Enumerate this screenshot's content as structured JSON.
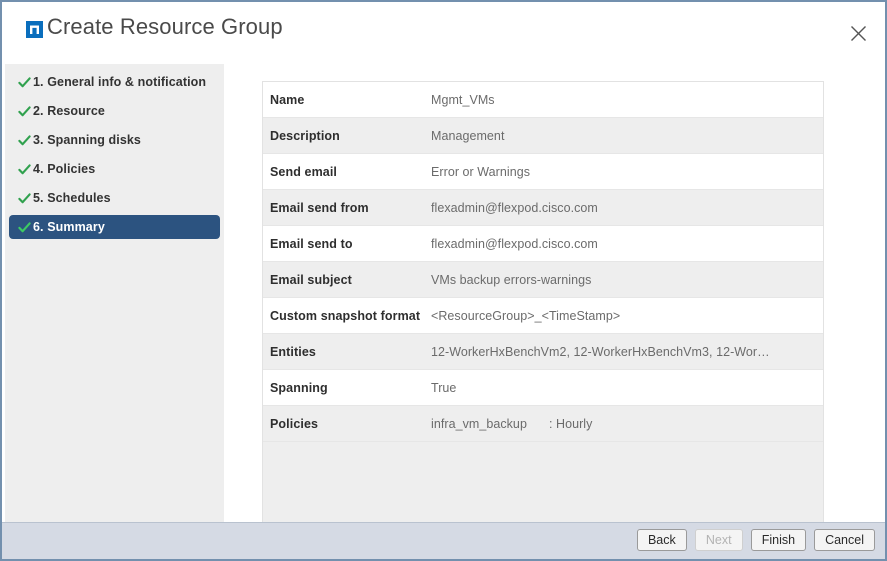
{
  "header": {
    "title": "Create Resource Group",
    "logo_icon": "netapp-logo-icon",
    "close_icon": "close-icon"
  },
  "sidebar": {
    "steps": [
      {
        "label": "1. General info & notification",
        "state": "complete",
        "icon": "check-icon"
      },
      {
        "label": "2. Resource",
        "state": "complete",
        "icon": "check-icon"
      },
      {
        "label": "3. Spanning disks",
        "state": "complete",
        "icon": "check-icon"
      },
      {
        "label": "4. Policies",
        "state": "complete",
        "icon": "check-icon"
      },
      {
        "label": "5. Schedules",
        "state": "complete",
        "icon": "check-icon"
      },
      {
        "label": "6. Summary",
        "state": "active",
        "icon": "check-icon"
      }
    ]
  },
  "summary": {
    "rows": [
      {
        "label": "Name",
        "value": "Mgmt_VMs"
      },
      {
        "label": "Description",
        "value": "Management"
      },
      {
        "label": "Send email",
        "value": "Error or Warnings"
      },
      {
        "label": "Email send from",
        "value": "flexadmin@flexpod.cisco.com"
      },
      {
        "label": "Email send to",
        "value": "flexadmin@flexpod.cisco.com"
      },
      {
        "label": "Email subject",
        "value": "VMs backup errors-warnings"
      },
      {
        "label": "Custom snapshot format",
        "value": "<ResourceGroup>_<TimeStamp>"
      },
      {
        "label": "Entities",
        "value": "12-WorkerHxBenchVm2, 12-WorkerHxBenchVm3, 12-Wor…"
      },
      {
        "label": "Spanning",
        "value": "True"
      },
      {
        "label": "Policies",
        "value": "infra_vm_backup",
        "value_suffix": ": Hourly"
      }
    ]
  },
  "footer": {
    "buttons": [
      {
        "label": "Back",
        "enabled": true
      },
      {
        "label": "Next",
        "enabled": false
      },
      {
        "label": "Finish",
        "enabled": true
      },
      {
        "label": "Cancel",
        "enabled": true
      }
    ]
  },
  "colors": {
    "accent_blue": "#0a6ebd",
    "active_step_bg": "#2c5380",
    "check_green": "#30a14e",
    "sidebar_bg": "#eeeeee",
    "footer_bg": "#d5dae4",
    "page_border": "#7390ae",
    "label_text": "#2e2e2e",
    "value_text": "#6b6b6b"
  }
}
